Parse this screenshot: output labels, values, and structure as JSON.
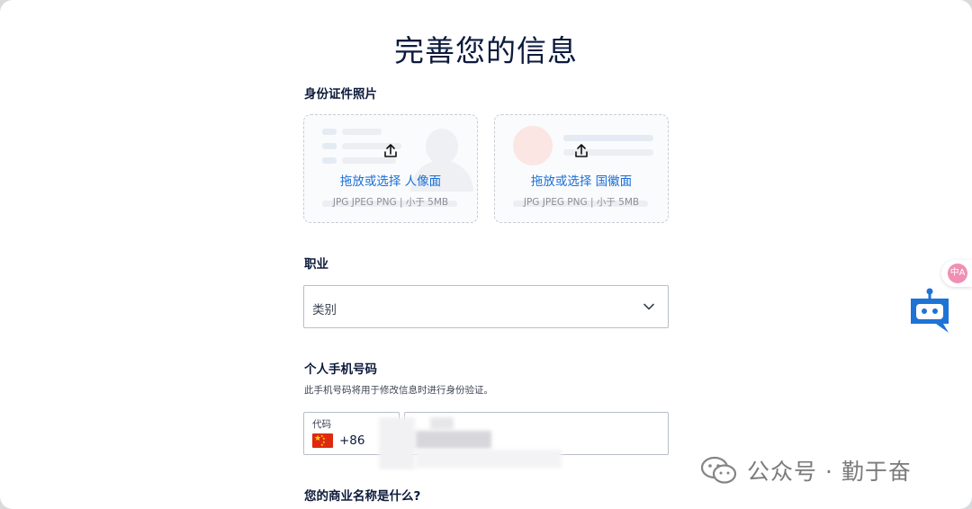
{
  "page": {
    "title": "完善您的信息"
  },
  "id_photo": {
    "label": "身份证件照片",
    "front": {
      "text": "拖放或选择 人像面",
      "hint": "JPG JPEG PNG  |  小于 5MB"
    },
    "back": {
      "text": "拖放或选择 国徽面",
      "hint": "JPG JPEG PNG  |  小于 5MB"
    }
  },
  "occupation": {
    "label": "职业",
    "placeholder": "类别"
  },
  "phone": {
    "label": "个人手机号码",
    "help": "此手机号码将用于修改信息时进行身份验证。",
    "code_label": "代码",
    "code_value": "+86"
  },
  "business": {
    "label": "您的商业名称是什么?"
  },
  "watermark": {
    "text": "公众号 · 勤于奋"
  },
  "translate": {
    "glyph": "中A"
  },
  "colors": {
    "accent": "#1a6fd6",
    "bot": "#1d73d6",
    "title": "#0b1a3d"
  }
}
